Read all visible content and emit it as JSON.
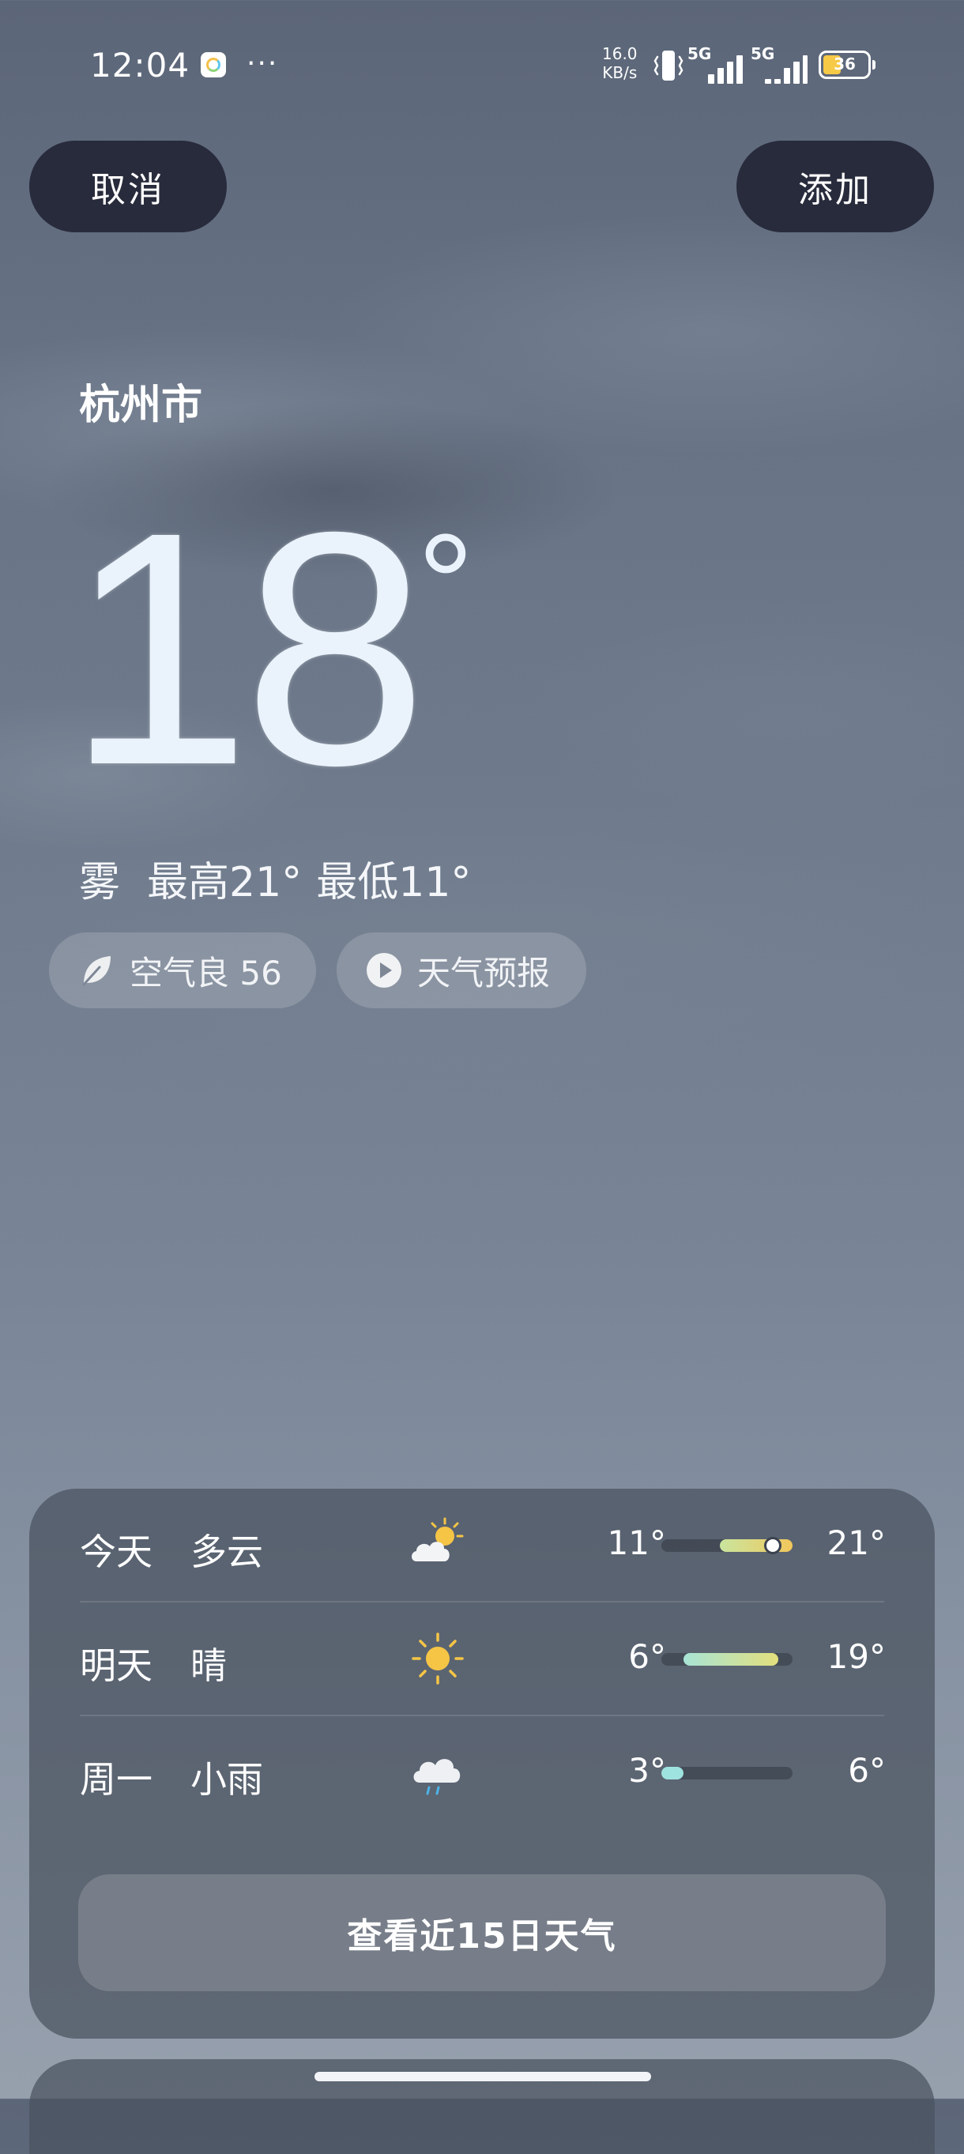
{
  "status_bar": {
    "time": "12:04",
    "more": "···",
    "net_speed_value": "16.0",
    "net_speed_unit": "KB/s",
    "sim1_type": "5G",
    "sim2_type": "5G",
    "battery_level": "36"
  },
  "header": {
    "cancel_label": "取消",
    "add_label": "添加"
  },
  "current": {
    "city": "杭州市",
    "temperature": "18",
    "unit": "°",
    "condition": "雾",
    "high": "最高21°",
    "low": "最低11°"
  },
  "chips": {
    "air_quality": "空气良 56",
    "forecast_video": "天气预报"
  },
  "daily": [
    {
      "day": "今天",
      "condition": "多云",
      "icon": "partly-cloudy-icon",
      "low": "11°",
      "high": "21°",
      "low_value": 11,
      "high_value": 21,
      "current_value": 18
    },
    {
      "day": "明天",
      "condition": "晴",
      "icon": "sunny-icon",
      "low": "6°",
      "high": "19°",
      "low_value": 6,
      "high_value": 19
    },
    {
      "day": "周一",
      "condition": "小雨",
      "icon": "light-rain-icon",
      "low": "3°",
      "high": "6°",
      "low_value": 3,
      "high_value": 6
    }
  ],
  "range_scale": {
    "min": 3,
    "max": 21
  },
  "more_button_label": "查看近15日天气",
  "colors": {
    "button_dark": "#282b3b",
    "range_warm": "#f2c75c",
    "range_cool": "#a8e4d6",
    "range_rain": "#9fe3e0"
  }
}
